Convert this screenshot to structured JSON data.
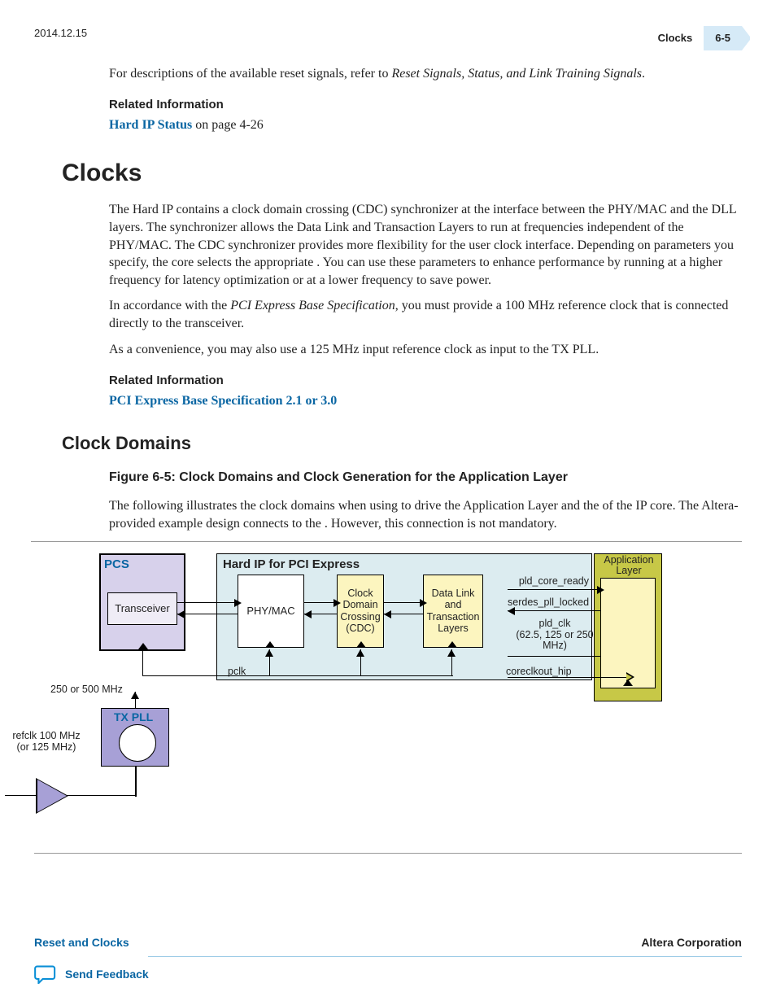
{
  "header": {
    "date": "2014.12.15",
    "section": "Clocks",
    "page": "6-5"
  },
  "intro": {
    "sentence_pre": "For descriptions of the available reset signals, refer to ",
    "sentence_ital": "Reset Signals, Status, and Link Training Signals",
    "sentence_post": ".",
    "related_label": "Related Information",
    "related_link": "Hard IP Status",
    "related_post": " on page 4-26"
  },
  "h1": "Clocks",
  "p1_a": "The Hard IP contains a clock domain crossing (CDC) synchronizer at the interface between the PHY/MAC and the DLL layers. The synchronizer allows the Data Link and Transaction Layers to run at frequencies independent of the PHY/MAC. The CDC synchronizer provides more flexibility for the user clock interface. Depending on parameters you specify, the core selects the appropriate ",
  "p1_b": ". You can use these parameters to enhance performance by running at a higher frequency for latency optimization or at a lower frequency to save power.",
  "p2_a": "In accordance with the ",
  "p2_ital": "PCI Express Base Specification",
  "p2_b": ", you must provide a 100 MHz reference clock that is connected directly to the transceiver.",
  "p3": "As a convenience, you may also use a 125 MHz input reference clock as input to the TX PLL.",
  "rel2_label": "Related Information",
  "rel2_link": "PCI Express Base Specification 2.1 or 3.0",
  "h2": "Clock Domains",
  "fig_caption": "Figure 6-5: Clock Domains and Clock Generation for the Application Layer",
  "fig_p_a": "The following illustrates the clock domains when using ",
  "fig_p_b": " to drive the Application Layer and the ",
  "fig_p_c": " of the IP core. The Altera-provided example design connects ",
  "fig_p_d": " to the ",
  "fig_p_e": ". However, this connection is not mandatory.",
  "diagram": {
    "pcs": "PCS",
    "transceiver": "Transceiver",
    "mhz_250_500": "250 or 500 MHz",
    "hardip": "Hard IP for PCI Express",
    "phymac": "PHY/MAC",
    "cdc": "Clock Domain Crossing (CDC)",
    "dll": "Data Link and Transaction Layers",
    "app": "Application Layer",
    "pclk": "pclk",
    "coreclkout": "coreclkout_hip",
    "sig1": "pld_core_ready",
    "sig2": "serdes_pll_locked",
    "sig3": "pld_clk",
    "sig3b": "(62.5, 125 or 250 MHz)",
    "txpll": "TX PLL",
    "refclk": "refclk 100 MHz (or 125 MHz)"
  },
  "footer": {
    "left": "Reset and Clocks",
    "right": "Altera Corporation",
    "feedback": "Send Feedback"
  }
}
